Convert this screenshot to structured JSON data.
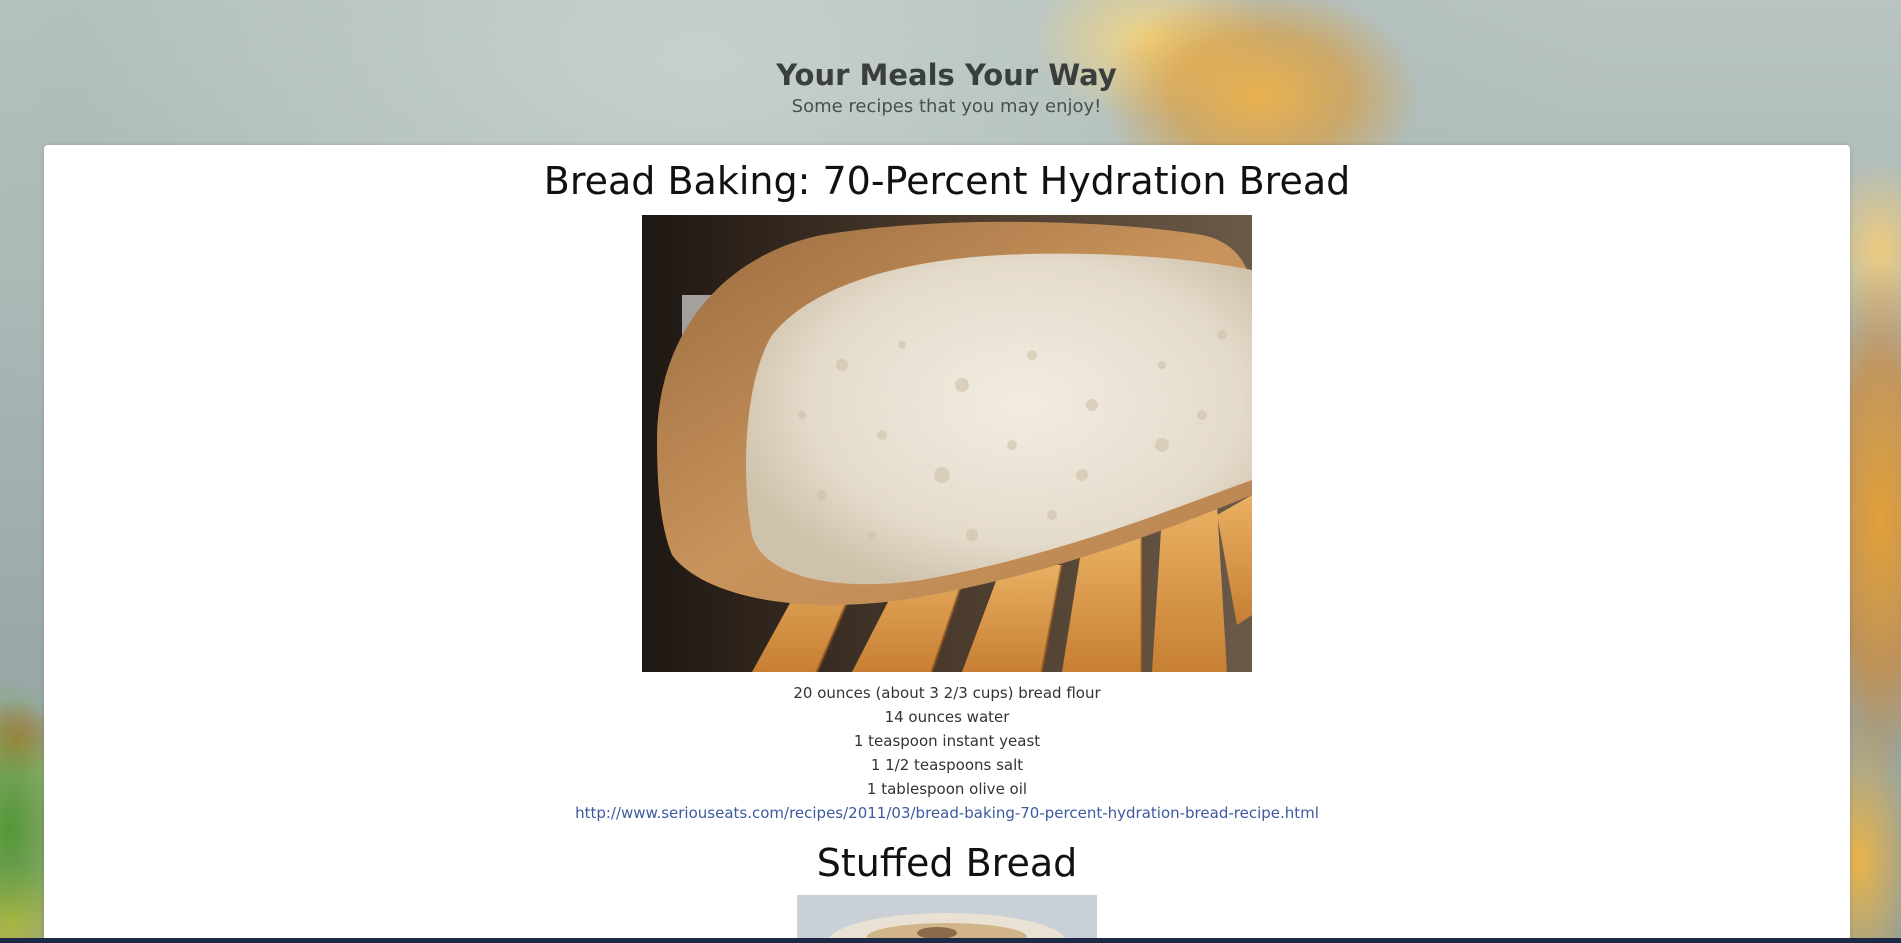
{
  "header": {
    "title": "Your Meals Your Way",
    "subtitle": "Some recipes that you may enjoy!"
  },
  "recipes": [
    {
      "title": "Bread Baking: 70-Percent Hydration Bread",
      "image": "photo of a halved loaf of bread on a wooden slatted board",
      "ingredients": [
        "20 ounces (about 3 2/3 cups) bread flour",
        "14 ounces water",
        "1 teaspoon instant yeast",
        "1 1/2 teaspoons salt",
        "1 tablespoon olive oil"
      ],
      "link": "http://www.seriouseats.com/recipes/2011/03/bread-baking-70-percent-hydration-bread-recipe.html"
    },
    {
      "title": "Stuffed Bread",
      "image": "photo of stuffed bread (cropped)"
    }
  ],
  "colors": {
    "link": "#3d5a9e",
    "card": "#ffffff",
    "bottom_bar": "#1c2a48"
  }
}
